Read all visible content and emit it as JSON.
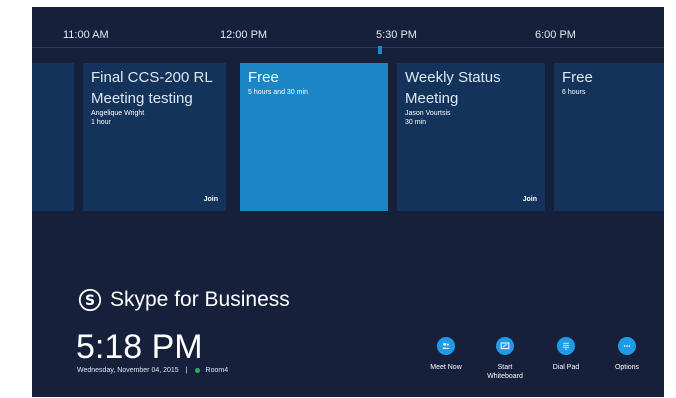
{
  "timeline": {
    "ticks": [
      "11:00 AM",
      "12:00 PM",
      "5:30 PM",
      "6:00 PM"
    ]
  },
  "cards": [
    {
      "title": "",
      "organizer": "",
      "duration": "",
      "join": ""
    },
    {
      "title_line1": "Final CCS-200 RL",
      "title_line2": "Meeting testing",
      "organizer": "Angelique Wright",
      "duration": "1 hour",
      "join": "Join"
    },
    {
      "title": "Free",
      "duration": "5 hours and 30 min"
    },
    {
      "title_line1": "Weekly Status",
      "title_line2": "Meeting",
      "organizer": "Jason Vourtsis",
      "duration": "30 min",
      "join": "Join"
    },
    {
      "title": "Free",
      "duration": "6 hours"
    }
  ],
  "brand": {
    "name": "Skype for Business",
    "icon": "skype-logo-icon"
  },
  "clock": {
    "time": "5:18 PM",
    "date": "Wednesday, November 04, 2015",
    "separator": "|",
    "room": "Room4",
    "status_color": "#27ae60"
  },
  "actions": [
    {
      "label_line1": "Meet Now",
      "label_line2": "",
      "icon": "people-icon"
    },
    {
      "label_line1": "Start",
      "label_line2": "Whiteboard",
      "icon": "whiteboard-icon"
    },
    {
      "label_line1": "Dial Pad",
      "label_line2": "",
      "icon": "dialpad-icon"
    },
    {
      "label_line1": "Options",
      "label_line2": "",
      "icon": "more-icon"
    }
  ],
  "colors": {
    "background": "#16203a",
    "card": "#14335a",
    "free_card": "#1b86c6",
    "accent": "#1e9be8"
  }
}
